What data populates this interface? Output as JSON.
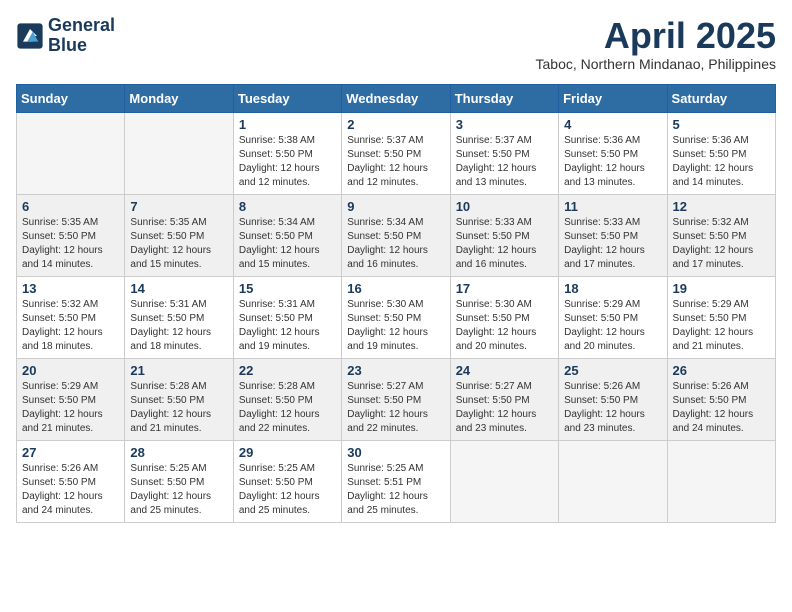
{
  "header": {
    "logo_line1": "General",
    "logo_line2": "Blue",
    "month": "April 2025",
    "location": "Taboc, Northern Mindanao, Philippines"
  },
  "weekdays": [
    "Sunday",
    "Monday",
    "Tuesday",
    "Wednesday",
    "Thursday",
    "Friday",
    "Saturday"
  ],
  "weeks": [
    [
      {
        "day": "",
        "sunrise": "",
        "sunset": "",
        "daylight": ""
      },
      {
        "day": "",
        "sunrise": "",
        "sunset": "",
        "daylight": ""
      },
      {
        "day": "1",
        "sunrise": "Sunrise: 5:38 AM",
        "sunset": "Sunset: 5:50 PM",
        "daylight": "Daylight: 12 hours and 12 minutes."
      },
      {
        "day": "2",
        "sunrise": "Sunrise: 5:37 AM",
        "sunset": "Sunset: 5:50 PM",
        "daylight": "Daylight: 12 hours and 12 minutes."
      },
      {
        "day": "3",
        "sunrise": "Sunrise: 5:37 AM",
        "sunset": "Sunset: 5:50 PM",
        "daylight": "Daylight: 12 hours and 13 minutes."
      },
      {
        "day": "4",
        "sunrise": "Sunrise: 5:36 AM",
        "sunset": "Sunset: 5:50 PM",
        "daylight": "Daylight: 12 hours and 13 minutes."
      },
      {
        "day": "5",
        "sunrise": "Sunrise: 5:36 AM",
        "sunset": "Sunset: 5:50 PM",
        "daylight": "Daylight: 12 hours and 14 minutes."
      }
    ],
    [
      {
        "day": "6",
        "sunrise": "Sunrise: 5:35 AM",
        "sunset": "Sunset: 5:50 PM",
        "daylight": "Daylight: 12 hours and 14 minutes."
      },
      {
        "day": "7",
        "sunrise": "Sunrise: 5:35 AM",
        "sunset": "Sunset: 5:50 PM",
        "daylight": "Daylight: 12 hours and 15 minutes."
      },
      {
        "day": "8",
        "sunrise": "Sunrise: 5:34 AM",
        "sunset": "Sunset: 5:50 PM",
        "daylight": "Daylight: 12 hours and 15 minutes."
      },
      {
        "day": "9",
        "sunrise": "Sunrise: 5:34 AM",
        "sunset": "Sunset: 5:50 PM",
        "daylight": "Daylight: 12 hours and 16 minutes."
      },
      {
        "day": "10",
        "sunrise": "Sunrise: 5:33 AM",
        "sunset": "Sunset: 5:50 PM",
        "daylight": "Daylight: 12 hours and 16 minutes."
      },
      {
        "day": "11",
        "sunrise": "Sunrise: 5:33 AM",
        "sunset": "Sunset: 5:50 PM",
        "daylight": "Daylight: 12 hours and 17 minutes."
      },
      {
        "day": "12",
        "sunrise": "Sunrise: 5:32 AM",
        "sunset": "Sunset: 5:50 PM",
        "daylight": "Daylight: 12 hours and 17 minutes."
      }
    ],
    [
      {
        "day": "13",
        "sunrise": "Sunrise: 5:32 AM",
        "sunset": "Sunset: 5:50 PM",
        "daylight": "Daylight: 12 hours and 18 minutes."
      },
      {
        "day": "14",
        "sunrise": "Sunrise: 5:31 AM",
        "sunset": "Sunset: 5:50 PM",
        "daylight": "Daylight: 12 hours and 18 minutes."
      },
      {
        "day": "15",
        "sunrise": "Sunrise: 5:31 AM",
        "sunset": "Sunset: 5:50 PM",
        "daylight": "Daylight: 12 hours and 19 minutes."
      },
      {
        "day": "16",
        "sunrise": "Sunrise: 5:30 AM",
        "sunset": "Sunset: 5:50 PM",
        "daylight": "Daylight: 12 hours and 19 minutes."
      },
      {
        "day": "17",
        "sunrise": "Sunrise: 5:30 AM",
        "sunset": "Sunset: 5:50 PM",
        "daylight": "Daylight: 12 hours and 20 minutes."
      },
      {
        "day": "18",
        "sunrise": "Sunrise: 5:29 AM",
        "sunset": "Sunset: 5:50 PM",
        "daylight": "Daylight: 12 hours and 20 minutes."
      },
      {
        "day": "19",
        "sunrise": "Sunrise: 5:29 AM",
        "sunset": "Sunset: 5:50 PM",
        "daylight": "Daylight: 12 hours and 21 minutes."
      }
    ],
    [
      {
        "day": "20",
        "sunrise": "Sunrise: 5:29 AM",
        "sunset": "Sunset: 5:50 PM",
        "daylight": "Daylight: 12 hours and 21 minutes."
      },
      {
        "day": "21",
        "sunrise": "Sunrise: 5:28 AM",
        "sunset": "Sunset: 5:50 PM",
        "daylight": "Daylight: 12 hours and 21 minutes."
      },
      {
        "day": "22",
        "sunrise": "Sunrise: 5:28 AM",
        "sunset": "Sunset: 5:50 PM",
        "daylight": "Daylight: 12 hours and 22 minutes."
      },
      {
        "day": "23",
        "sunrise": "Sunrise: 5:27 AM",
        "sunset": "Sunset: 5:50 PM",
        "daylight": "Daylight: 12 hours and 22 minutes."
      },
      {
        "day": "24",
        "sunrise": "Sunrise: 5:27 AM",
        "sunset": "Sunset: 5:50 PM",
        "daylight": "Daylight: 12 hours and 23 minutes."
      },
      {
        "day": "25",
        "sunrise": "Sunrise: 5:26 AM",
        "sunset": "Sunset: 5:50 PM",
        "daylight": "Daylight: 12 hours and 23 minutes."
      },
      {
        "day": "26",
        "sunrise": "Sunrise: 5:26 AM",
        "sunset": "Sunset: 5:50 PM",
        "daylight": "Daylight: 12 hours and 24 minutes."
      }
    ],
    [
      {
        "day": "27",
        "sunrise": "Sunrise: 5:26 AM",
        "sunset": "Sunset: 5:50 PM",
        "daylight": "Daylight: 12 hours and 24 minutes."
      },
      {
        "day": "28",
        "sunrise": "Sunrise: 5:25 AM",
        "sunset": "Sunset: 5:50 PM",
        "daylight": "Daylight: 12 hours and 25 minutes."
      },
      {
        "day": "29",
        "sunrise": "Sunrise: 5:25 AM",
        "sunset": "Sunset: 5:50 PM",
        "daylight": "Daylight: 12 hours and 25 minutes."
      },
      {
        "day": "30",
        "sunrise": "Sunrise: 5:25 AM",
        "sunset": "Sunset: 5:51 PM",
        "daylight": "Daylight: 12 hours and 25 minutes."
      },
      {
        "day": "",
        "sunrise": "",
        "sunset": "",
        "daylight": ""
      },
      {
        "day": "",
        "sunrise": "",
        "sunset": "",
        "daylight": ""
      },
      {
        "day": "",
        "sunrise": "",
        "sunset": "",
        "daylight": ""
      }
    ]
  ]
}
